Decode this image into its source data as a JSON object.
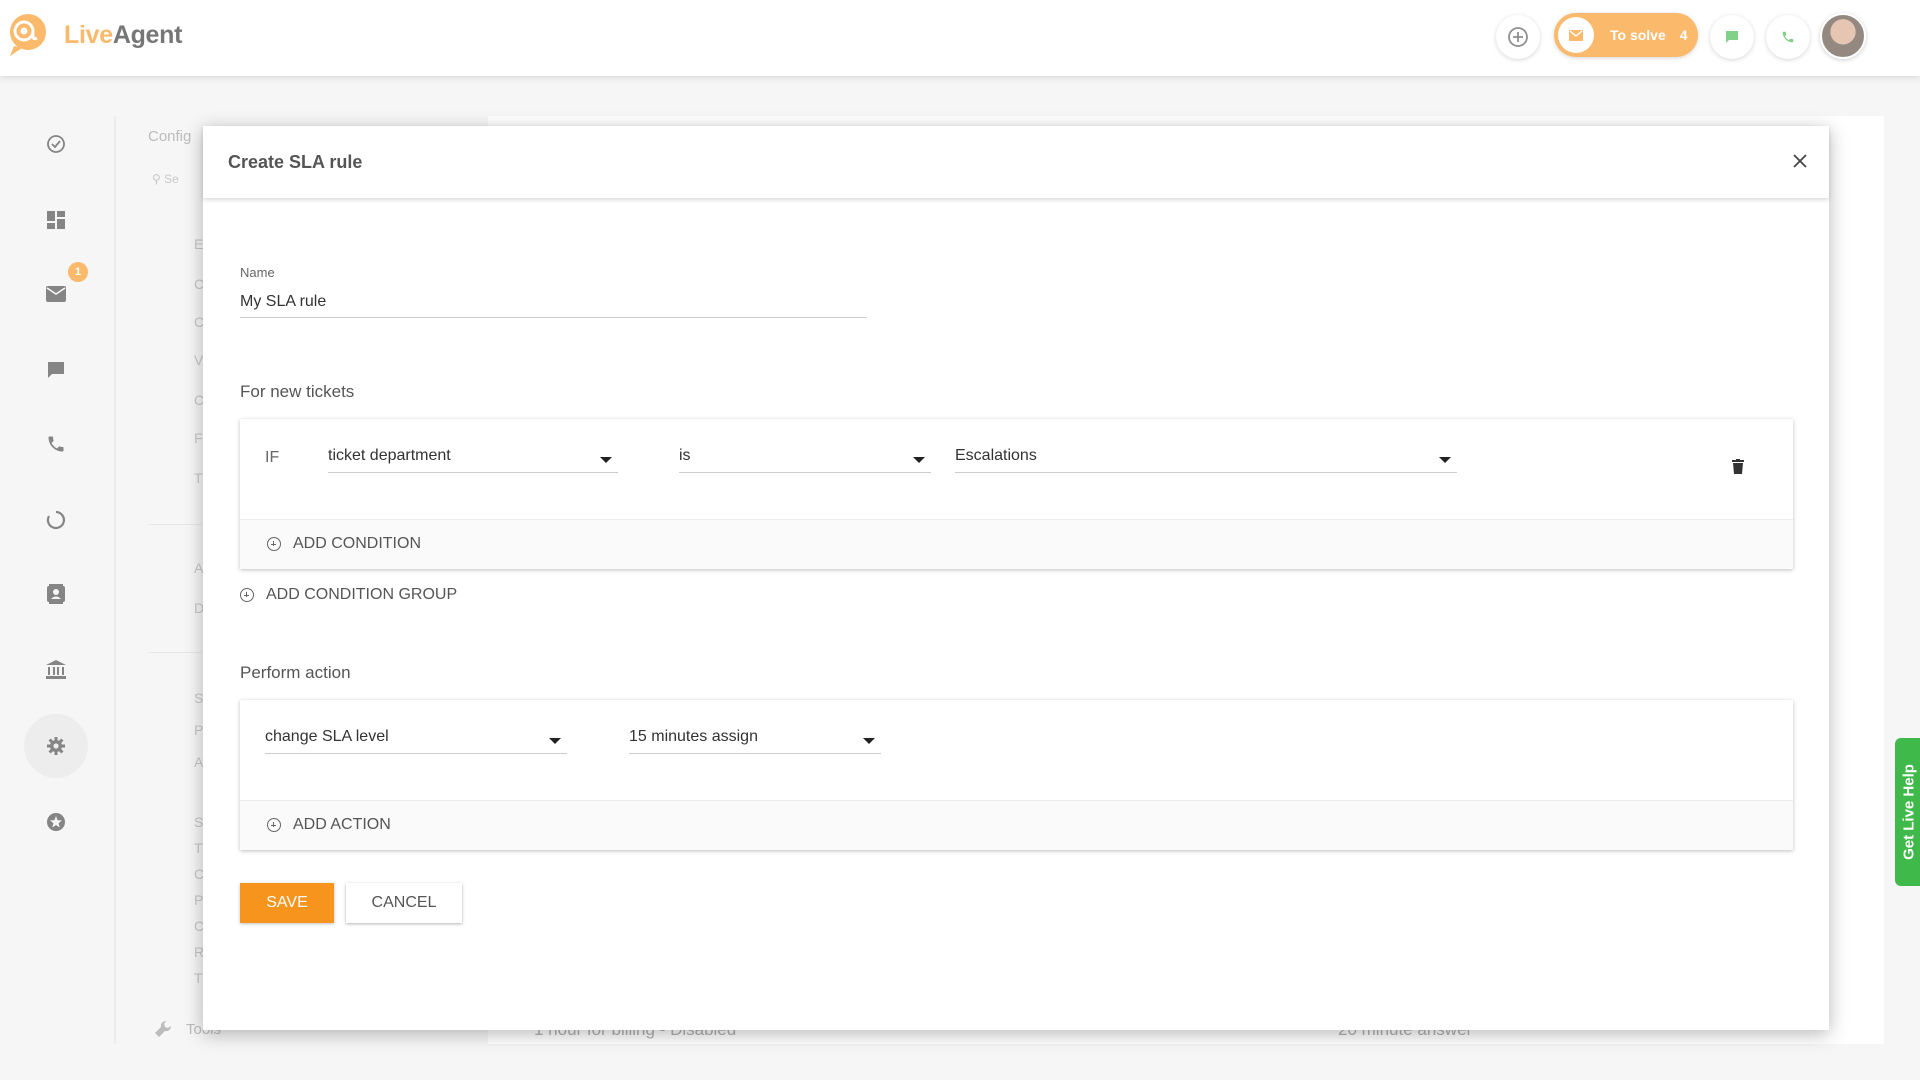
{
  "app": {
    "logo_live": "Live",
    "logo_agent": "Agent"
  },
  "topbar": {
    "to_solve_label": "To solve",
    "to_solve_count": "4",
    "icons": [
      "add-circle-icon",
      "mail-icon",
      "chat-icon",
      "phone-icon",
      "user-avatar"
    ]
  },
  "leftnav": {
    "items": [
      "check-circle-icon",
      "dashboard-icon",
      "mail-icon",
      "chat-icon",
      "phone-icon",
      "spinner-icon",
      "contacts-icon",
      "knowledgebase-icon",
      "settings-icon",
      "star-icon"
    ],
    "mail_badge": "1",
    "active": "settings-icon"
  },
  "background": {
    "config_title": "Config",
    "search_placeholder": "Se",
    "letters": [
      "E",
      "C",
      "C",
      "V",
      "C",
      "F",
      "T",
      "A",
      "D",
      "S",
      "P",
      "A",
      "S",
      "T",
      "C",
      "P",
      "C",
      "R",
      "T"
    ],
    "tools_label": "Tools",
    "bottom_text_left": "1 hour for billing - Disabled",
    "bottom_text_right": "20 minute answer"
  },
  "modal": {
    "title": "Create SLA rule",
    "name_label": "Name",
    "name_value": "My SLA rule",
    "conditions_title": "For new tickets",
    "condition": {
      "prefix": "IF",
      "field": "ticket department",
      "operator": "is",
      "value": "Escalations"
    },
    "add_condition": "ADD CONDITION",
    "add_condition_group": "ADD CONDITION GROUP",
    "actions_title": "Perform action",
    "action": {
      "type": "change SLA level",
      "value": "15 minutes assign"
    },
    "add_action": "ADD ACTION",
    "save_label": "SAVE",
    "cancel_label": "CANCEL"
  },
  "live_help": "Get Live Help",
  "colors": {
    "accent": "#f7941d",
    "live_help": "#3fb949"
  }
}
